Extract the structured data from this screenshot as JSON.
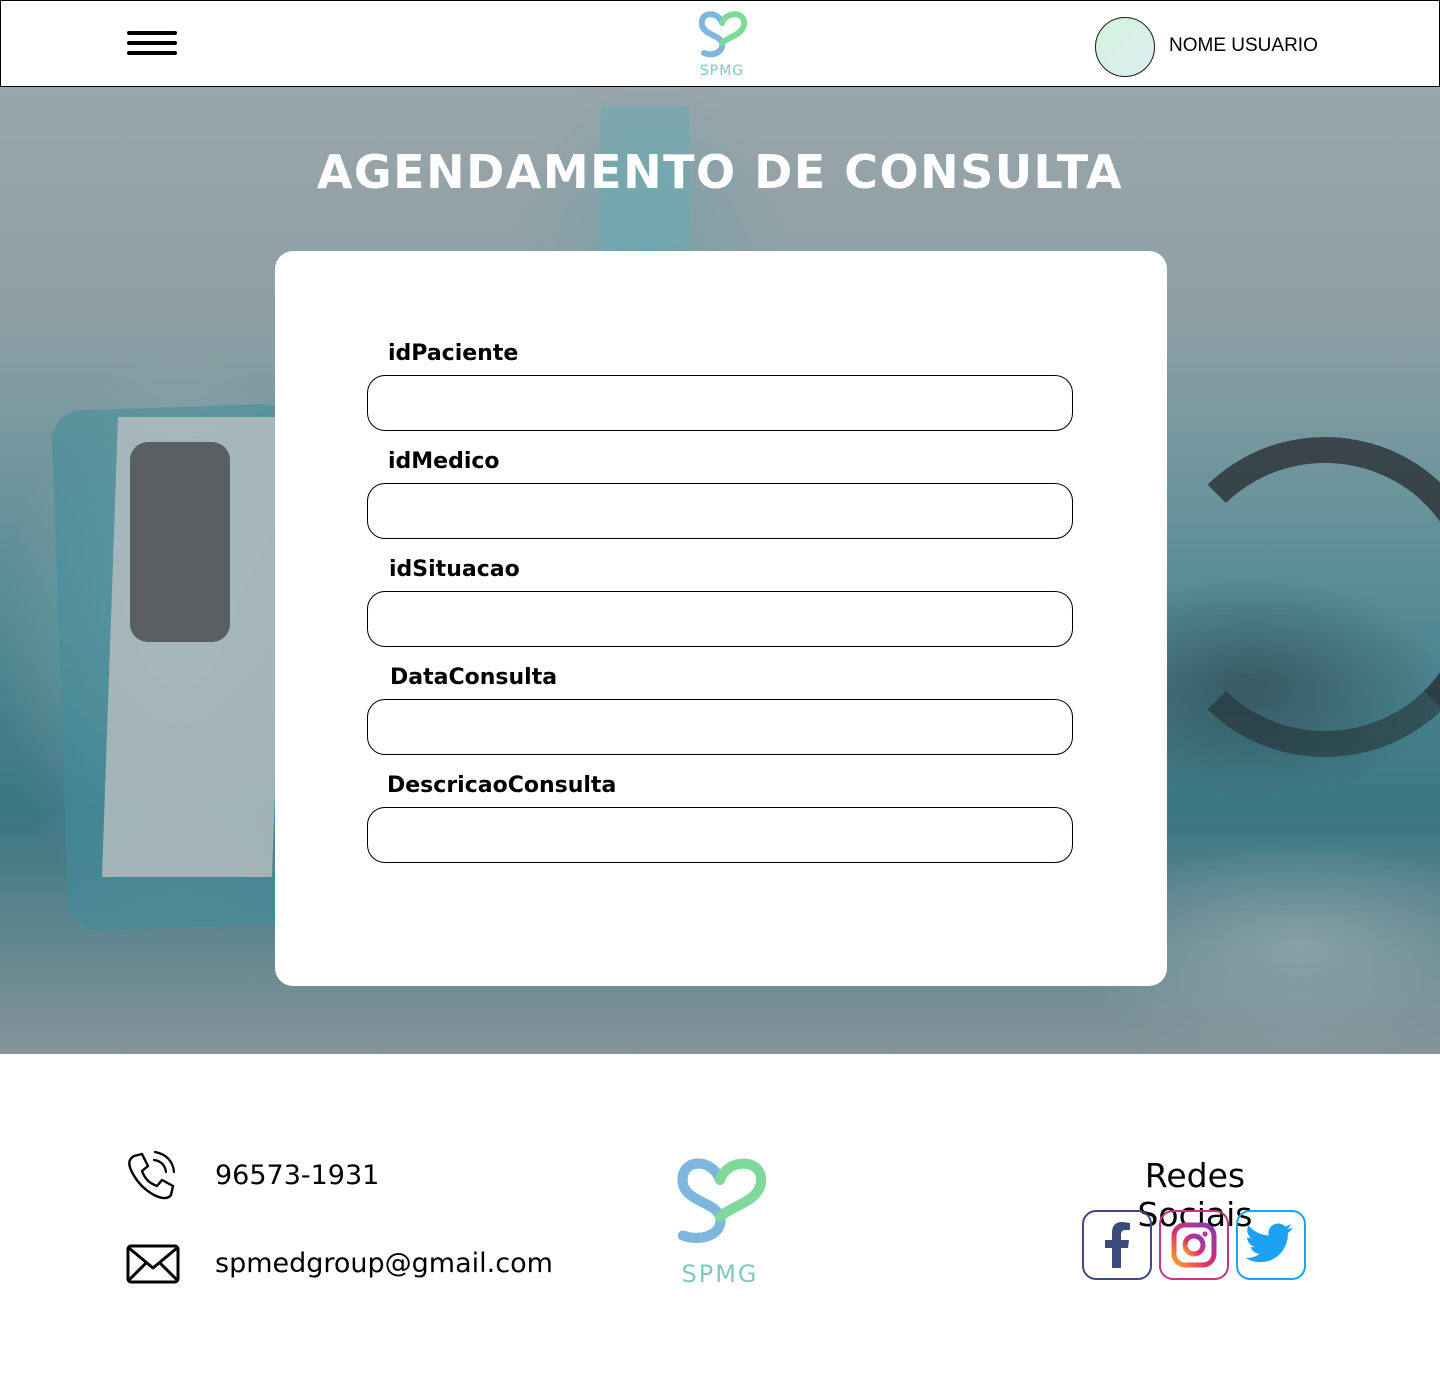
{
  "header": {
    "logo_text": "SPMG",
    "username": "NOME USUARIO"
  },
  "page": {
    "title": "AGENDAMENTO DE CONSULTA"
  },
  "form": {
    "fields": [
      {
        "label": "idPaciente",
        "value": ""
      },
      {
        "label": "idMedico",
        "value": ""
      },
      {
        "label": "idSituacao",
        "value": ""
      },
      {
        "label": "DataConsulta",
        "value": ""
      },
      {
        "label": "DescricaoConsulta",
        "value": ""
      }
    ]
  },
  "footer": {
    "phone": "96573-1931",
    "email": "spmedgroup@gmail.com",
    "logo_text": "SPMG",
    "social_title": "Redes Sociais",
    "social_icons": [
      "facebook-icon",
      "instagram-icon",
      "twitter-icon"
    ]
  },
  "colors": {
    "brand_green": "#7ed99a",
    "brand_blue": "#7fb6e0",
    "facebook": "#3b4a7a",
    "twitter": "#1da1f2"
  }
}
